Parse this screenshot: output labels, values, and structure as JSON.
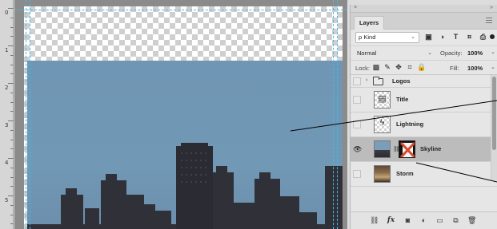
{
  "ruler": {
    "labels": [
      "0",
      "1",
      "2",
      "3",
      "4",
      "5"
    ]
  },
  "panel": {
    "close_glyph": "×",
    "collapse_glyph": "»",
    "tab_label": "Layers",
    "filter": {
      "kind_label": "ρ Kind",
      "icons": [
        "image-filter-icon",
        "adjustment-filter-icon",
        "type-filter-icon",
        "shape-filter-icon",
        "smart-object-filter-icon"
      ]
    },
    "blend_mode": "Normal",
    "opacity_label": "Opacity:",
    "opacity_value": "100%",
    "lock_label": "Lock:",
    "fill_label": "Fill:",
    "fill_value": "100%",
    "layers": [
      {
        "name": "Logos",
        "kind": "group",
        "visible": false,
        "expanded": false
      },
      {
        "name": "Title",
        "kind": "layer",
        "visible": false
      },
      {
        "name": "Lightning",
        "kind": "layer",
        "visible": false
      },
      {
        "name": "Skyline",
        "kind": "layer-with-mask",
        "visible": true,
        "selected": true
      },
      {
        "name": "Storm",
        "kind": "layer",
        "visible": false
      }
    ],
    "footer_icons": [
      "link-layers-icon",
      "fx-icon",
      "add-mask-icon",
      "adjustment-layer-icon",
      "new-group-icon",
      "new-layer-icon",
      "trash-icon"
    ]
  },
  "colors": {
    "guide": "#46b9e6",
    "sky": "#7198b5",
    "buildings": "#2f3038",
    "selected_row": "#bcbcbc",
    "mask_cross": "#d9482b"
  }
}
